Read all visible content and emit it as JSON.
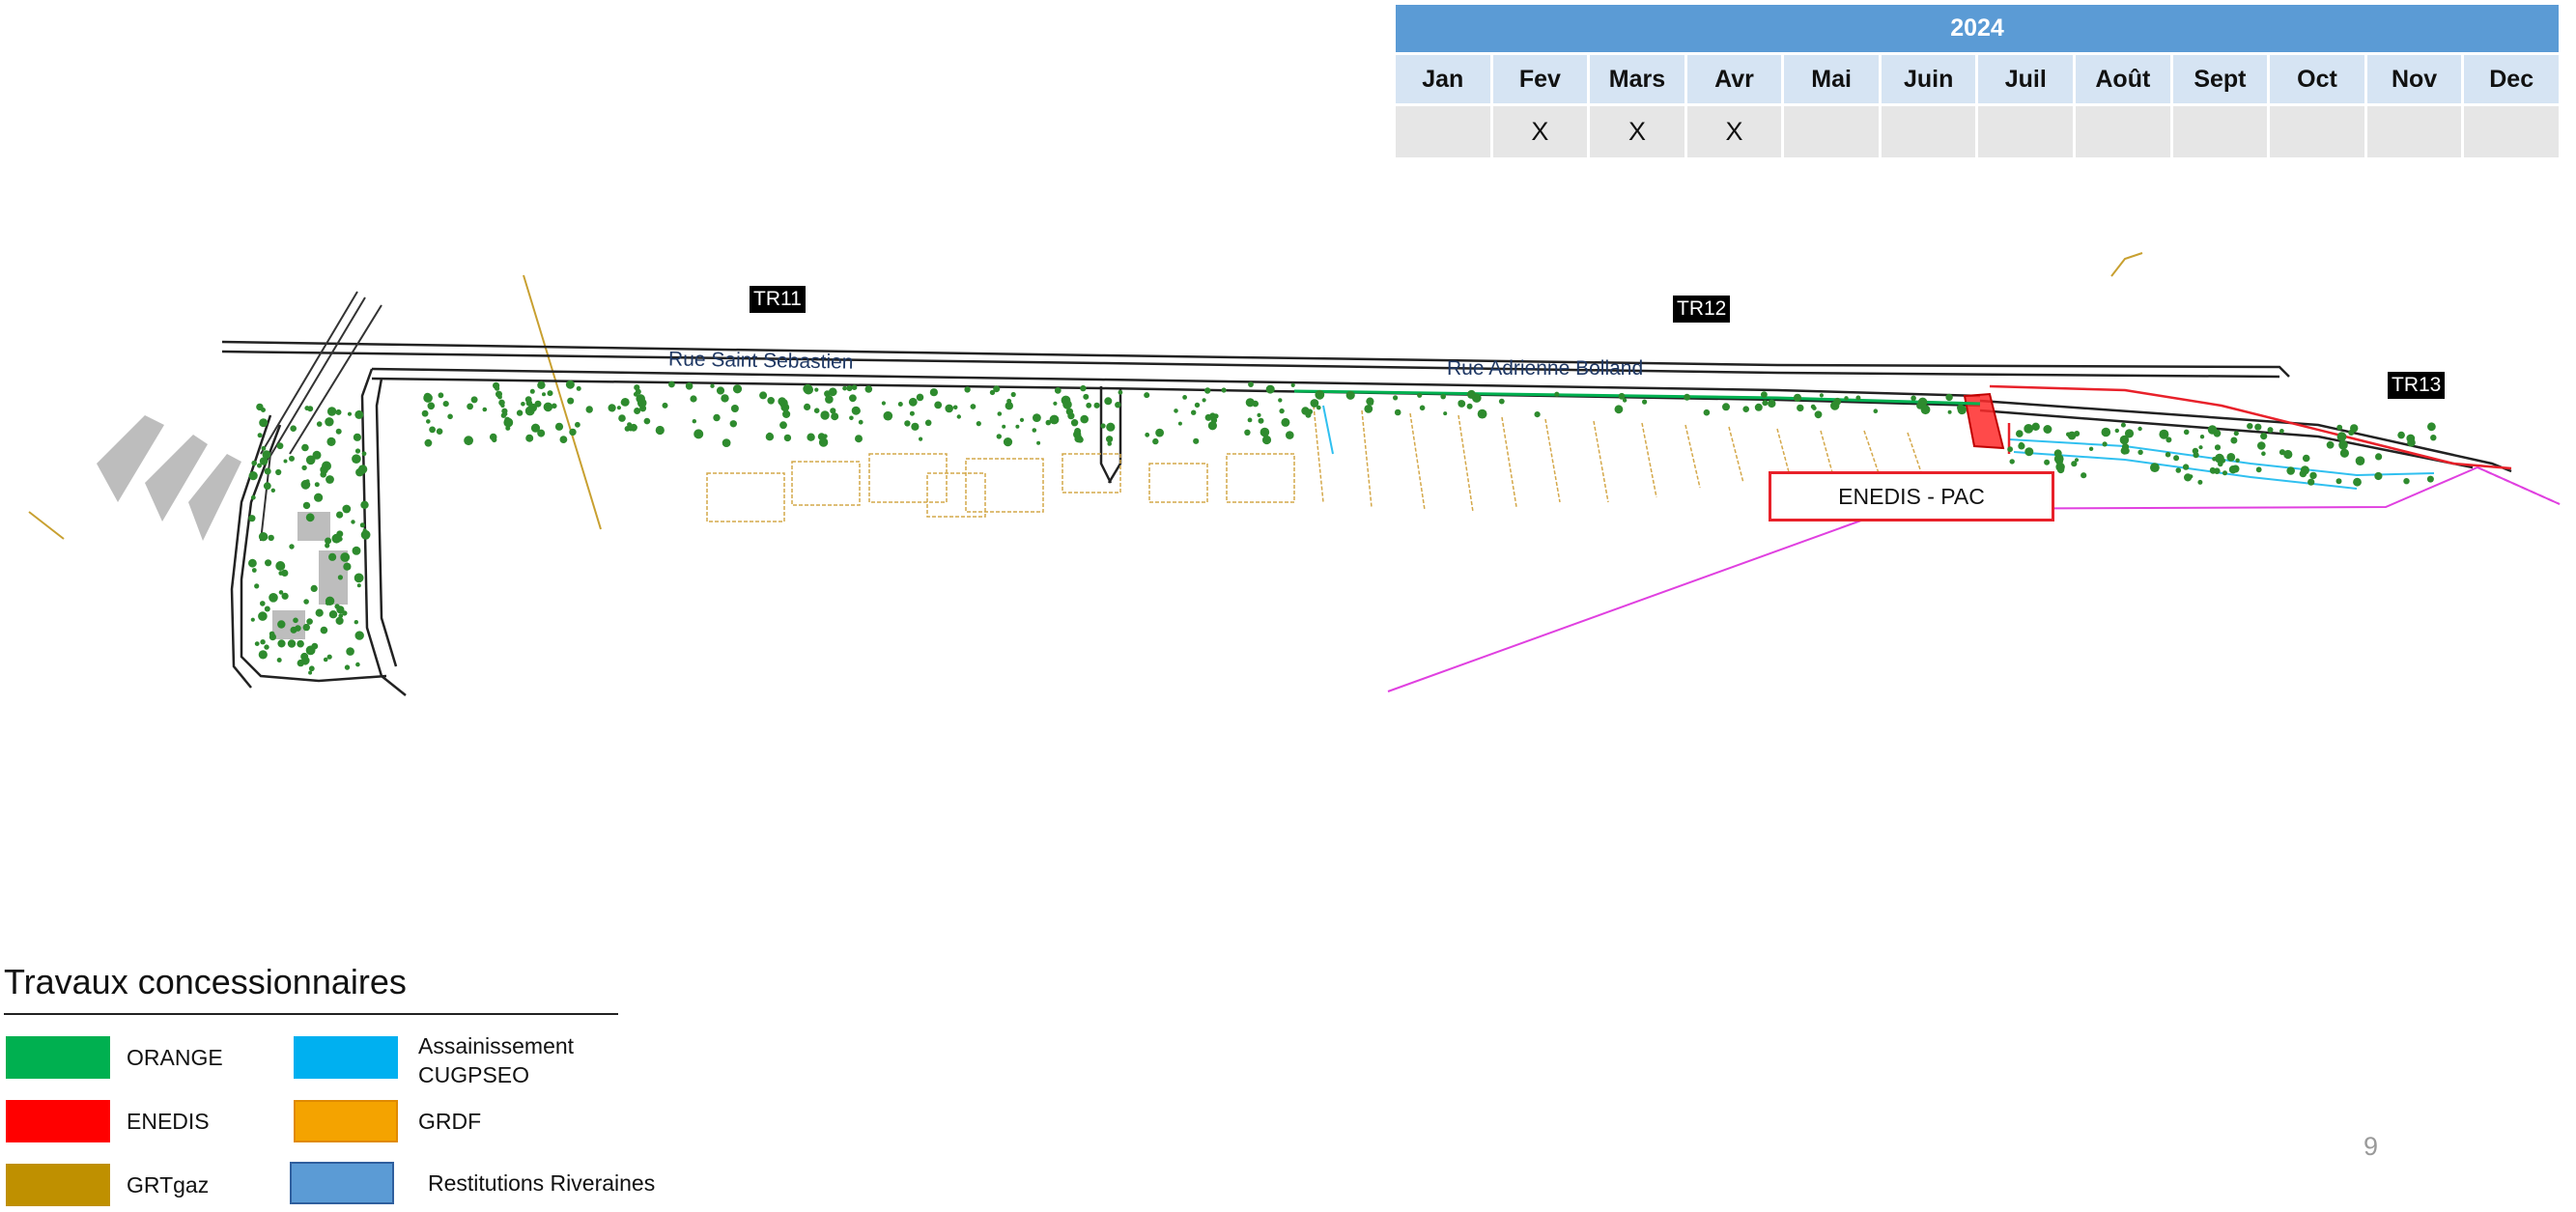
{
  "schedule": {
    "year": "2024",
    "months": [
      "Jan",
      "Fev",
      "Mars",
      "Avr",
      "Mai",
      "Juin",
      "Juil",
      "Août",
      "Sept",
      "Oct",
      "Nov",
      "Dec"
    ],
    "marks": [
      "",
      "X",
      "X",
      "X",
      "",
      "",
      "",
      "",
      "",
      "",
      "",
      ""
    ]
  },
  "map": {
    "sections": {
      "tr11": "TR11",
      "tr12": "TR12",
      "tr13": "TR13"
    },
    "streets": {
      "saint_sebastien": "Rue Saint Sebastien",
      "adrienne_bolland": "Rue Adrienne Bolland"
    },
    "callout": "ENEDIS - PAC"
  },
  "legend": {
    "title": "Travaux concessionnaires",
    "items": [
      {
        "label": "ORANGE",
        "color": "#00b050"
      },
      {
        "label": "ENEDIS",
        "color": "#ff0000"
      },
      {
        "label": "GRTgaz",
        "color": "#bf9000"
      },
      {
        "label_line1": "Assainissement",
        "label_line2": "CUGPSEO",
        "color": "#00b0f0"
      },
      {
        "label": "GRDF",
        "color": "#f4a300"
      },
      {
        "label": "Restitutions Riveraines",
        "color": "#5b9bd5"
      }
    ]
  },
  "page_number": "9"
}
